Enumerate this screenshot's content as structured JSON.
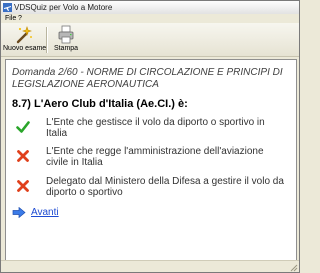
{
  "window": {
    "title": "VDSQuiz per Volo a Motore"
  },
  "menu": {
    "items": [
      "File",
      "?"
    ]
  },
  "toolbar": {
    "new_exam_label": "Nuovo esame",
    "print_label": "Stampa"
  },
  "quiz": {
    "header": "Domanda 2/60 - NORME DI CIRCOLAZIONE E PRINCIPI DI LEGISLAZIONE AERONAUTICA",
    "question": "8.7) L'Aero Club d'Italia (Ae.CI.) è:",
    "answers": [
      {
        "text": "L'Ente che gestisce il volo da diporto o sportivo in Italia",
        "icon": "check-icon",
        "correct": true,
        "color": "#2aa52a"
      },
      {
        "text": "L'Ente che regge l'amministrazione dell'aviazione civile in Italia",
        "icon": "cross-icon",
        "correct": false,
        "color": "#e0401c"
      },
      {
        "text": "Delegato dal Ministero della Difesa a gestire il volo da diporto o sportivo",
        "icon": "cross-icon",
        "correct": false,
        "color": "#e0401c"
      }
    ],
    "next_label": "Avanti"
  }
}
